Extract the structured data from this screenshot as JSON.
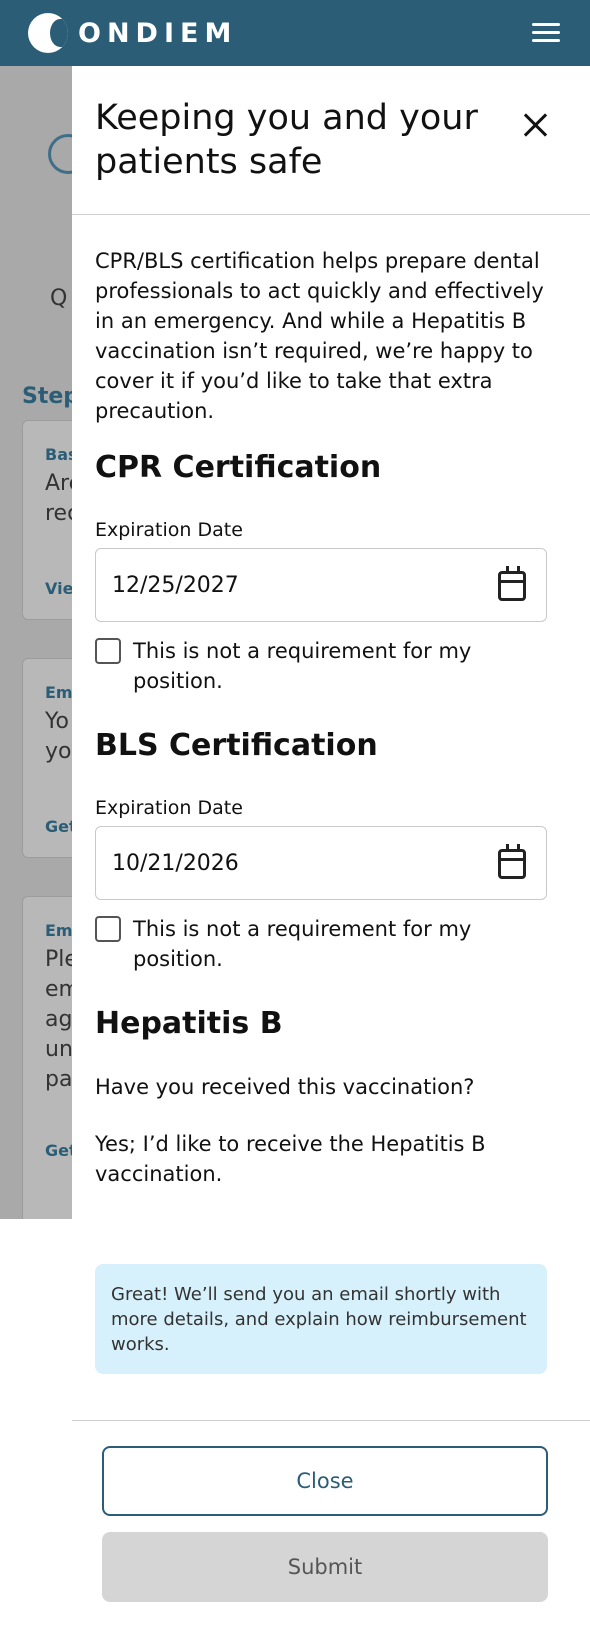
{
  "header": {
    "brand": "ONDIEM"
  },
  "background": {
    "partial_title": "C",
    "partial_q": "Q",
    "partial_steps": "Step",
    "cards": [
      {
        "label": "Bas",
        "lines": [
          "Are",
          "rec"
        ],
        "link": "Vie"
      },
      {
        "label": "Em",
        "lines": [
          "Yo",
          "yo"
        ],
        "link": "Get"
      },
      {
        "label": "Em",
        "lines": [
          "Ple",
          "em",
          "ag",
          "un",
          "pa"
        ],
        "link": "Get"
      }
    ]
  },
  "drawer": {
    "title": "Keeping you and your patients safe",
    "intro": "CPR/BLS certification helps prepare dental professionals to act quickly and effectively in an emergency. And while a Hepatitis B vaccination isn’t required, we’re happy to cover it if you’d like to take that extra precaution.",
    "cpr": {
      "heading": "CPR Certification",
      "field_label": "Expiration Date",
      "value": "12/25/2027",
      "checkbox_label": "This is not a requirement for my position.",
      "checked": false
    },
    "bls": {
      "heading": "BLS Certification",
      "field_label": "Expiration Date",
      "value": "10/21/2026",
      "checkbox_label": "This is not a requirement for my position.",
      "checked": false
    },
    "hepb": {
      "heading": "Hepatitis B",
      "question": "Have you received this vaccination?",
      "answer": "Yes; I’d like to receive the Hepatitis B vaccination.",
      "notice": "Great! We’ll send you an email shortly with more details, and explain how reimbursement works."
    },
    "buttons": {
      "close": "Close",
      "submit": "Submit"
    }
  },
  "colors": {
    "brand": "#2b5e76",
    "notice_bg": "#d6f1fb",
    "disabled_btn": "#d5d5d5"
  }
}
